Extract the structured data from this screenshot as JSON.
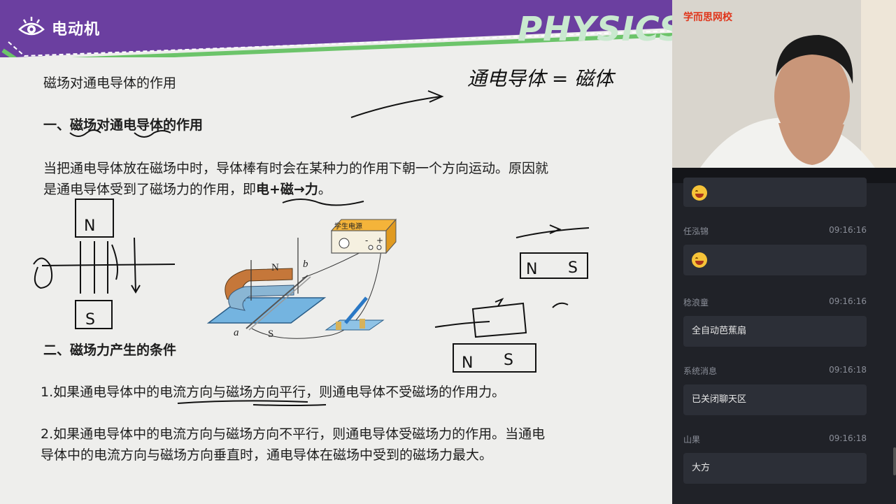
{
  "header": {
    "title": "电动机",
    "watermark": "PHYSICS",
    "color_primary": "#6b3fa0",
    "color_accent": "#5cb85c"
  },
  "slide": {
    "subtitle": "磁场对通电导体的作用",
    "section1_heading": "一、磁场对通电导体的作用",
    "para1_line1": "当把通电导体放在磁场中时，导体棒有时会在某种力的作用下朝一个方向运动。原因就",
    "para1_line2_prefix": "是通电导体受到了磁场力的作用，即",
    "para1_line2_bold": "电+磁→力",
    "para1_line2_suffix": "。",
    "section2_heading": "二、磁场力产生的条件",
    "point1": "1.如果通电导体中的电流方向与磁场方向平行，则通电导体不受磁场的作用力。",
    "point2_line1": "2.如果通电导体中的电流方向与磁场方向不平行，则通电导体受磁场力的作用。当通电",
    "point2_line2": "导体中的电流方向与磁场方向垂直时，通电导体在磁场中受到的磁场力最大。",
    "apparatus": {
      "N": "N",
      "S": "S",
      "a": "a",
      "b": "b",
      "power_label": "学生电源",
      "minus": "-",
      "plus": "+"
    }
  },
  "annotations": {
    "handwriting_top": "通电导体 = 磁体",
    "magnet_N": "N",
    "magnet_S": "S"
  },
  "video": {
    "logo": "学而思网校"
  },
  "chat": {
    "messages": [
      {
        "name": "",
        "time": "",
        "text": "",
        "emoji": "laughing-face"
      },
      {
        "name": "任泓锦",
        "time": "09:16:16",
        "text": "",
        "emoji": "laughing-face"
      },
      {
        "name": "稔浪童",
        "time": "09:16:16",
        "text": "全自动芭蕉扇"
      },
      {
        "name": "系统消息",
        "time": "09:16:18",
        "text": "已关闭聊天区"
      },
      {
        "name": "山果",
        "time": "09:16:18",
        "text": "大方"
      }
    ]
  }
}
